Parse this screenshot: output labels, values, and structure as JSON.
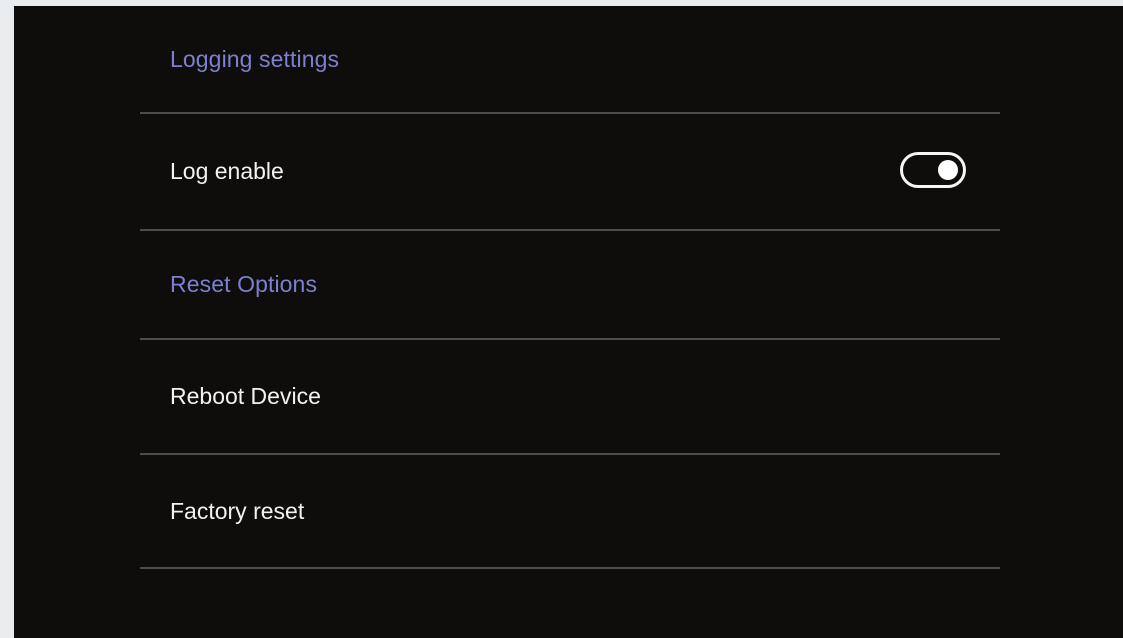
{
  "sections": [
    {
      "header": "Logging settings",
      "items": [
        {
          "label": "Log enable",
          "toggle": {
            "state": "on"
          }
        }
      ]
    },
    {
      "header": "Reset Options",
      "items": [
        {
          "label": "Reboot Device"
        },
        {
          "label": "Factory reset"
        }
      ]
    }
  ],
  "colors": {
    "background": "#0e0d0c",
    "section_header": "#7d7fcf",
    "item_text": "#f2f2f2",
    "divider": "#4c4c4c",
    "outer_background": "#e9edf0"
  }
}
